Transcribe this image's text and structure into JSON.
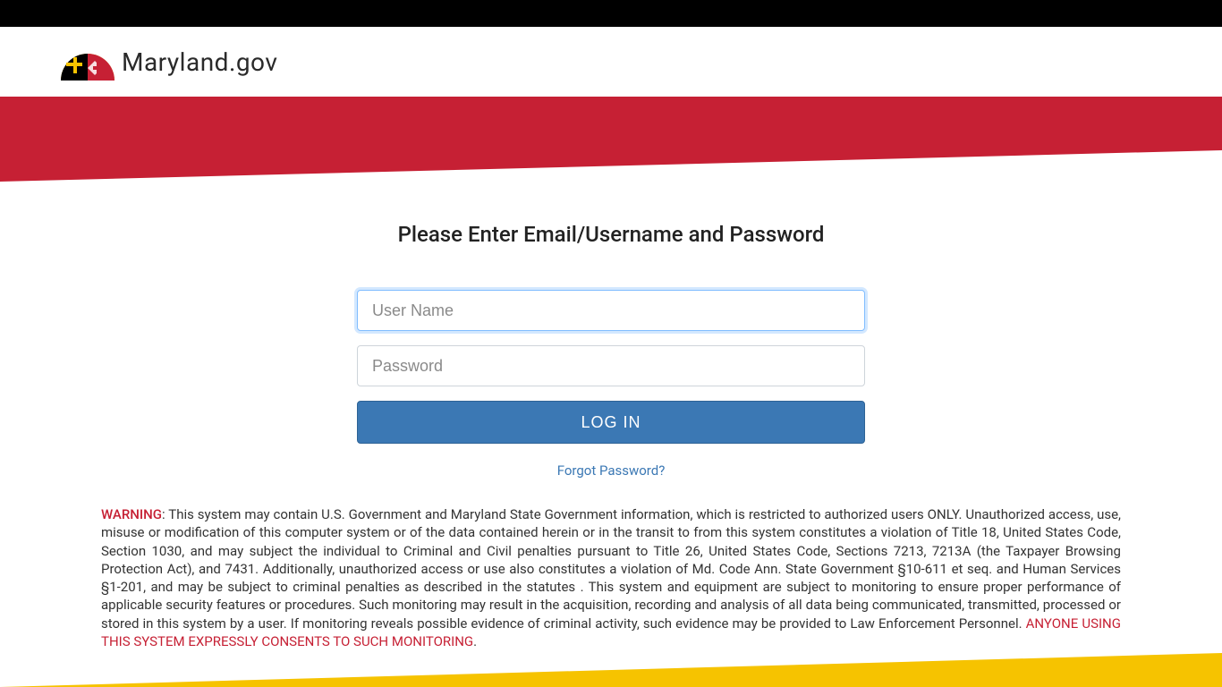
{
  "logo": {
    "text": "Maryland.gov"
  },
  "heading": "Please Enter Email/Username and Password",
  "form": {
    "username_placeholder": "User Name",
    "password_placeholder": "Password",
    "login_button": "LOG IN",
    "forgot_password": "Forgot Password?"
  },
  "warning": {
    "label": "WARNING",
    "body": ": This system may contain U.S. Government and Maryland State Government information, which is restricted to authorized users ONLY. Unauthorized access, use, misuse or modification of this computer system or of the data contained herein or in the transit to from this system constitutes a violation of Title 18, United States Code, Section 1030, and may subject the individual to Criminal and Civil penalties pursuant to Title 26, United States Code, Sections 7213, 7213A (the Taxpayer Browsing Protection Act), and 7431. Additionally, unauthorized access or use also constitutes a violation of Md. Code Ann. State Government §10-611 et seq. and Human Services §1-201, and may be subject to criminal penalties as described in the statutes . This system and equipment are subject to monitoring to ensure proper performance of applicable security features or procedures. Such monitoring may result in the acquisition, recording and analysis of all data being communicated, transmitted, processed or stored in this system by a user. If monitoring reveals possible evidence of criminal activity, such evidence may be provided to Law Enforcement Personnel. ",
    "consent": "ANYONE USING THIS SYSTEM EXPRESSLY CONSENTS TO SUCH MONITORING",
    "period": "."
  }
}
